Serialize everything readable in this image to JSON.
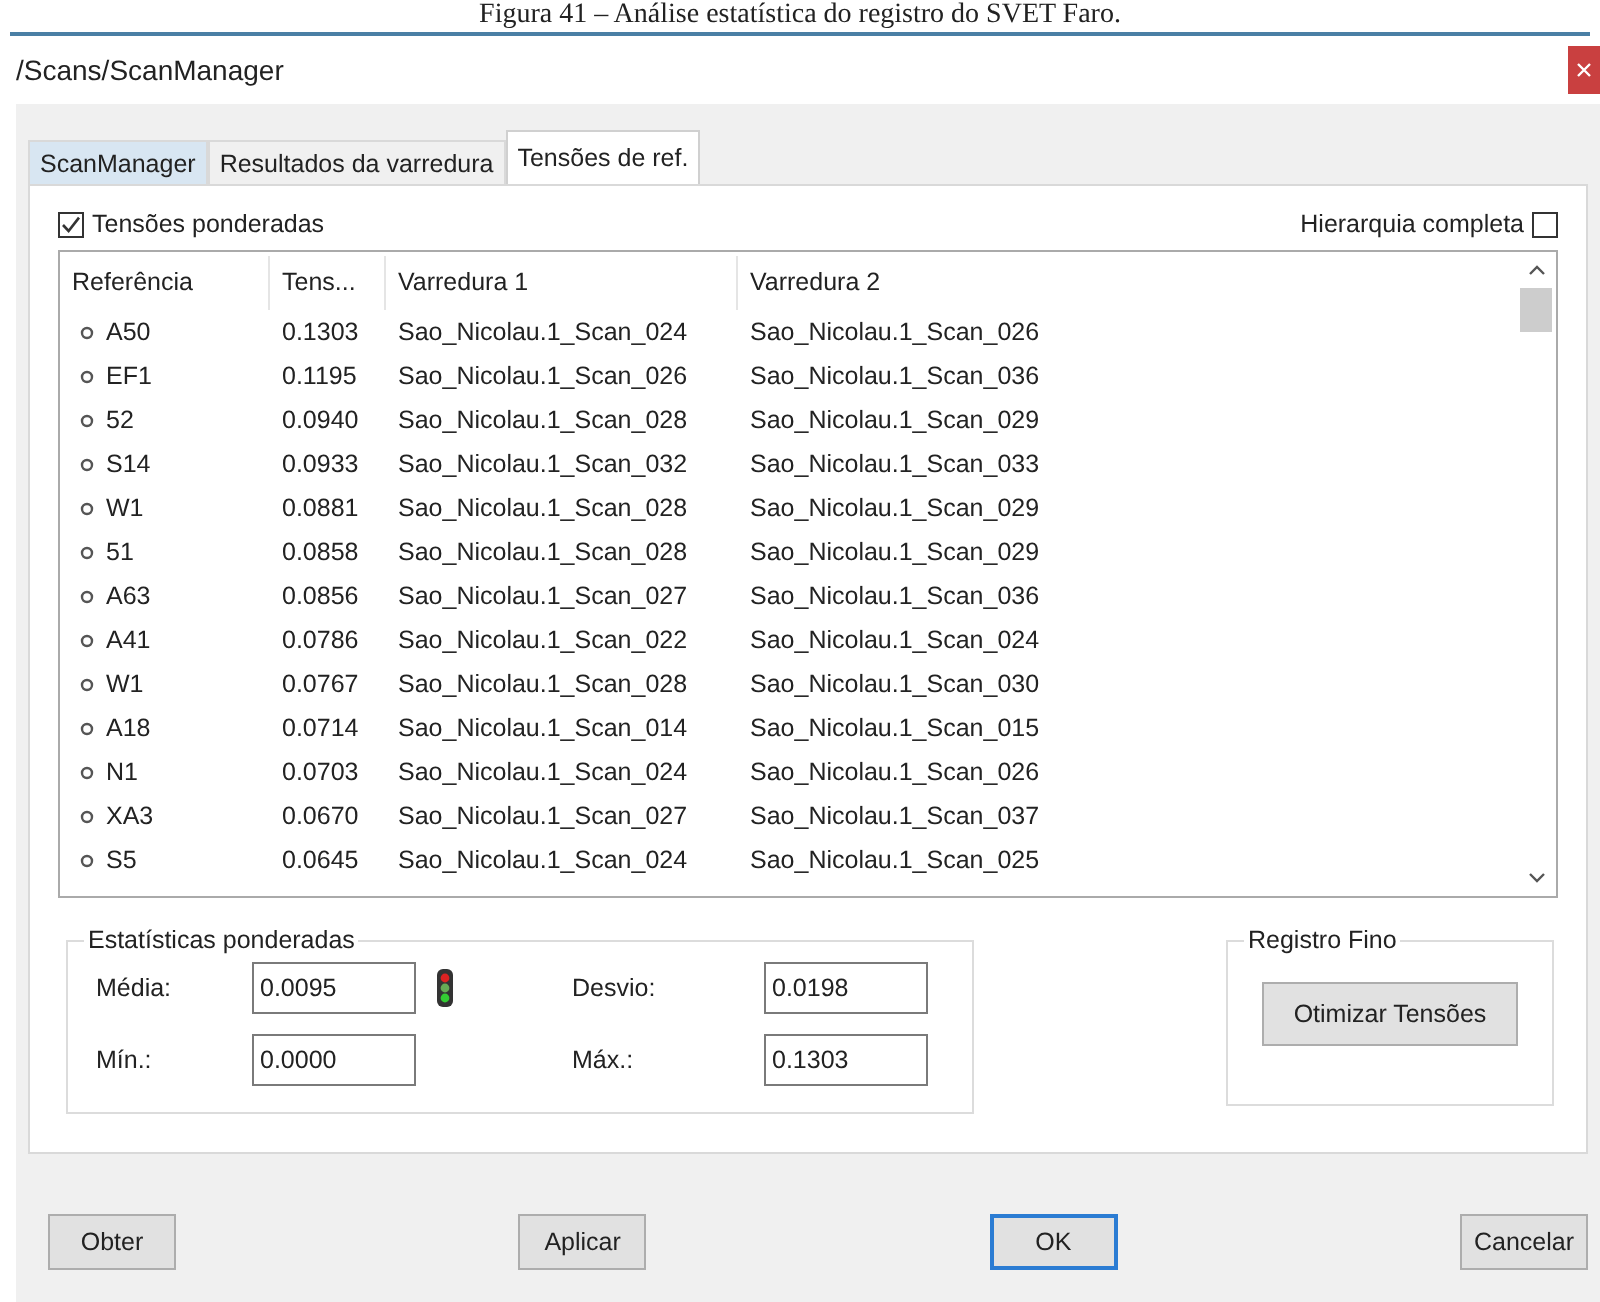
{
  "caption": "Figura 41 – Análise estatística do registro do SVET Faro.",
  "window": {
    "title": "/Scans/ScanManager"
  },
  "tabs": [
    {
      "label": "ScanManager",
      "selected": false,
      "highlighted": true
    },
    {
      "label": "Resultados da varredura",
      "selected": false,
      "highlighted": false
    },
    {
      "label": "Tensões de ref.",
      "selected": true,
      "highlighted": false
    }
  ],
  "weighted_checkbox": {
    "label": "Tensões ponderadas",
    "checked": true
  },
  "hierarchy_checkbox": {
    "label": "Hierarquia completa",
    "checked": false
  },
  "table": {
    "columns": [
      "Referência",
      "Tens...",
      "Varredura 1",
      "Varredura 2"
    ],
    "rows": [
      {
        "reference": "A50",
        "tension": "0.1303",
        "scan_1": "Sao_Nicolau.1_Scan_024",
        "scan_2": "Sao_Nicolau.1_Scan_026"
      },
      {
        "reference": "EF1",
        "tension": "0.1195",
        "scan_1": "Sao_Nicolau.1_Scan_026",
        "scan_2": "Sao_Nicolau.1_Scan_036"
      },
      {
        "reference": "52",
        "tension": "0.0940",
        "scan_1": "Sao_Nicolau.1_Scan_028",
        "scan_2": "Sao_Nicolau.1_Scan_029"
      },
      {
        "reference": "S14",
        "tension": "0.0933",
        "scan_1": "Sao_Nicolau.1_Scan_032",
        "scan_2": "Sao_Nicolau.1_Scan_033"
      },
      {
        "reference": "W1",
        "tension": "0.0881",
        "scan_1": "Sao_Nicolau.1_Scan_028",
        "scan_2": "Sao_Nicolau.1_Scan_029"
      },
      {
        "reference": "51",
        "tension": "0.0858",
        "scan_1": "Sao_Nicolau.1_Scan_028",
        "scan_2": "Sao_Nicolau.1_Scan_029"
      },
      {
        "reference": "A63",
        "tension": "0.0856",
        "scan_1": "Sao_Nicolau.1_Scan_027",
        "scan_2": "Sao_Nicolau.1_Scan_036"
      },
      {
        "reference": "A41",
        "tension": "0.0786",
        "scan_1": "Sao_Nicolau.1_Scan_022",
        "scan_2": "Sao_Nicolau.1_Scan_024"
      },
      {
        "reference": "W1",
        "tension": "0.0767",
        "scan_1": "Sao_Nicolau.1_Scan_028",
        "scan_2": "Sao_Nicolau.1_Scan_030"
      },
      {
        "reference": "A18",
        "tension": "0.0714",
        "scan_1": "Sao_Nicolau.1_Scan_014",
        "scan_2": "Sao_Nicolau.1_Scan_015"
      },
      {
        "reference": "N1",
        "tension": "0.0703",
        "scan_1": "Sao_Nicolau.1_Scan_024",
        "scan_2": "Sao_Nicolau.1_Scan_026"
      },
      {
        "reference": "XA3",
        "tension": "0.0670",
        "scan_1": "Sao_Nicolau.1_Scan_027",
        "scan_2": "Sao_Nicolau.1_Scan_037"
      },
      {
        "reference": "S5",
        "tension": "0.0645",
        "scan_1": "Sao_Nicolau.1_Scan_024",
        "scan_2": "Sao_Nicolau.1_Scan_025"
      }
    ]
  },
  "weighted_stats": {
    "title": "Estatísticas ponderadas",
    "fields": [
      {
        "label": "Média:",
        "value": "0.0095"
      },
      {
        "label": "Desvio:",
        "value": "0.0198"
      },
      {
        "label": "Mín.:",
        "value": "0.0000"
      },
      {
        "label": "Máx.:",
        "value": "0.1303"
      }
    ]
  },
  "fine_registration": {
    "title": "Registro Fino",
    "button": "Otimizar Tensões"
  },
  "buttons": [
    {
      "label": "Obter",
      "default": false
    },
    {
      "label": "Aplicar",
      "default": false
    },
    {
      "label": "OK",
      "default": true
    },
    {
      "label": "Cancelar",
      "default": false
    }
  ]
}
